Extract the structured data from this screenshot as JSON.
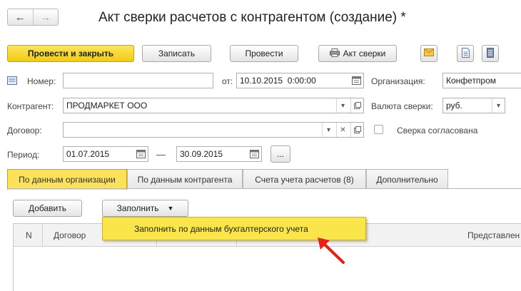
{
  "navigation": {
    "back_icon": "arrow-left",
    "forward_icon": "arrow-right"
  },
  "window": {
    "title": "Акт сверки расчетов с контрагентом (создание) *"
  },
  "toolbar": {
    "post_close": "Провести и закрыть",
    "save": "Записать",
    "post": "Провести",
    "print_act": "Акт сверки",
    "print_icon": "printer-icon",
    "mail_icon": "envelope-icon",
    "doc_icon": "document-icon",
    "list_icon": "list-icon"
  },
  "form": {
    "number_label": "Номер:",
    "number_value": "",
    "from_label": "от:",
    "date_value": "10.10.2015  0:00:00",
    "org_label": "Организация:",
    "org_value": "Конфетпром",
    "counterparty_label": "Контрагент:",
    "counterparty_value": "ПРОДМАРКЕТ ООО",
    "currency_label": "Валюта сверки:",
    "currency_value": "руб.",
    "contract_label": "Договор:",
    "contract_value": "",
    "agreed_label": "Сверка согласована",
    "agreed_checked": false,
    "period_label": "Период:",
    "period_start": "01.07.2015",
    "period_dash": "—",
    "period_end": "30.09.2015",
    "period_more": "..."
  },
  "tabs": [
    {
      "label": "По данным организации",
      "active": true
    },
    {
      "label": "По данным контрагента",
      "active": false
    },
    {
      "label": "Счета учета расчетов (8)",
      "active": false
    },
    {
      "label": "Дополнительно",
      "active": false
    }
  ],
  "table_toolbar": {
    "add": "Добавить",
    "fill": "Заполнить",
    "fill_arrow": "▼"
  },
  "table": {
    "columns": [
      "N",
      "Договор",
      "Представлен"
    ]
  },
  "dropdown_menu": {
    "items": [
      "Заполнить по данным бухгалтерского учета"
    ]
  },
  "colors": {
    "accent_yellow": "#fbe25a",
    "primary_button": "#f0cb16",
    "arrow_red": "#e8201a"
  }
}
